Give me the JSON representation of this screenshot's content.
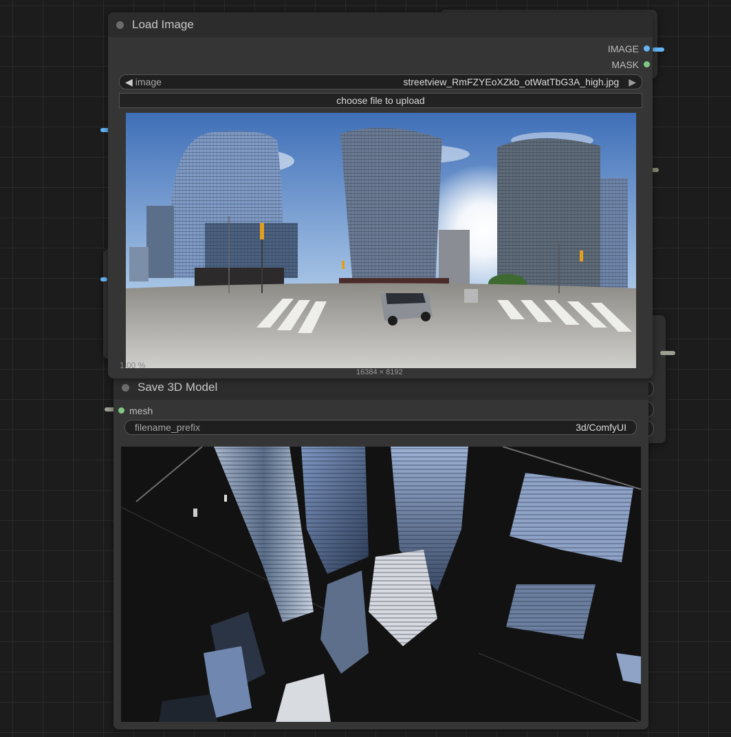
{
  "load_image_node": {
    "title": "Load Image",
    "outputs": [
      {
        "label": "IMAGE",
        "color": "#64b5f6"
      },
      {
        "label": "MASK",
        "color": "#81c784"
      }
    ],
    "image_widget": {
      "label": "image",
      "value": "streetview_RmFZYEoXZkb_otWatTbG3A_high.jpg"
    },
    "upload_button": "choose file to upload",
    "preview_dimensions": "16384 × 8192"
  },
  "behind_node": {
    "partial_label": "1.00 %"
  },
  "save_3d_node": {
    "title": "Save 3D Model",
    "inputs": [
      {
        "label": "mesh",
        "color": "#81c784"
      }
    ],
    "filename_widget": {
      "label": "filename_prefix",
      "value": "3d/ComfyUI"
    }
  },
  "colors": {
    "canvas": "#1c1c1c",
    "node_body": "#353535",
    "node_header": "#2c2c2c",
    "image_slot": "#64b5f6",
    "mask_slot": "#81c784"
  }
}
